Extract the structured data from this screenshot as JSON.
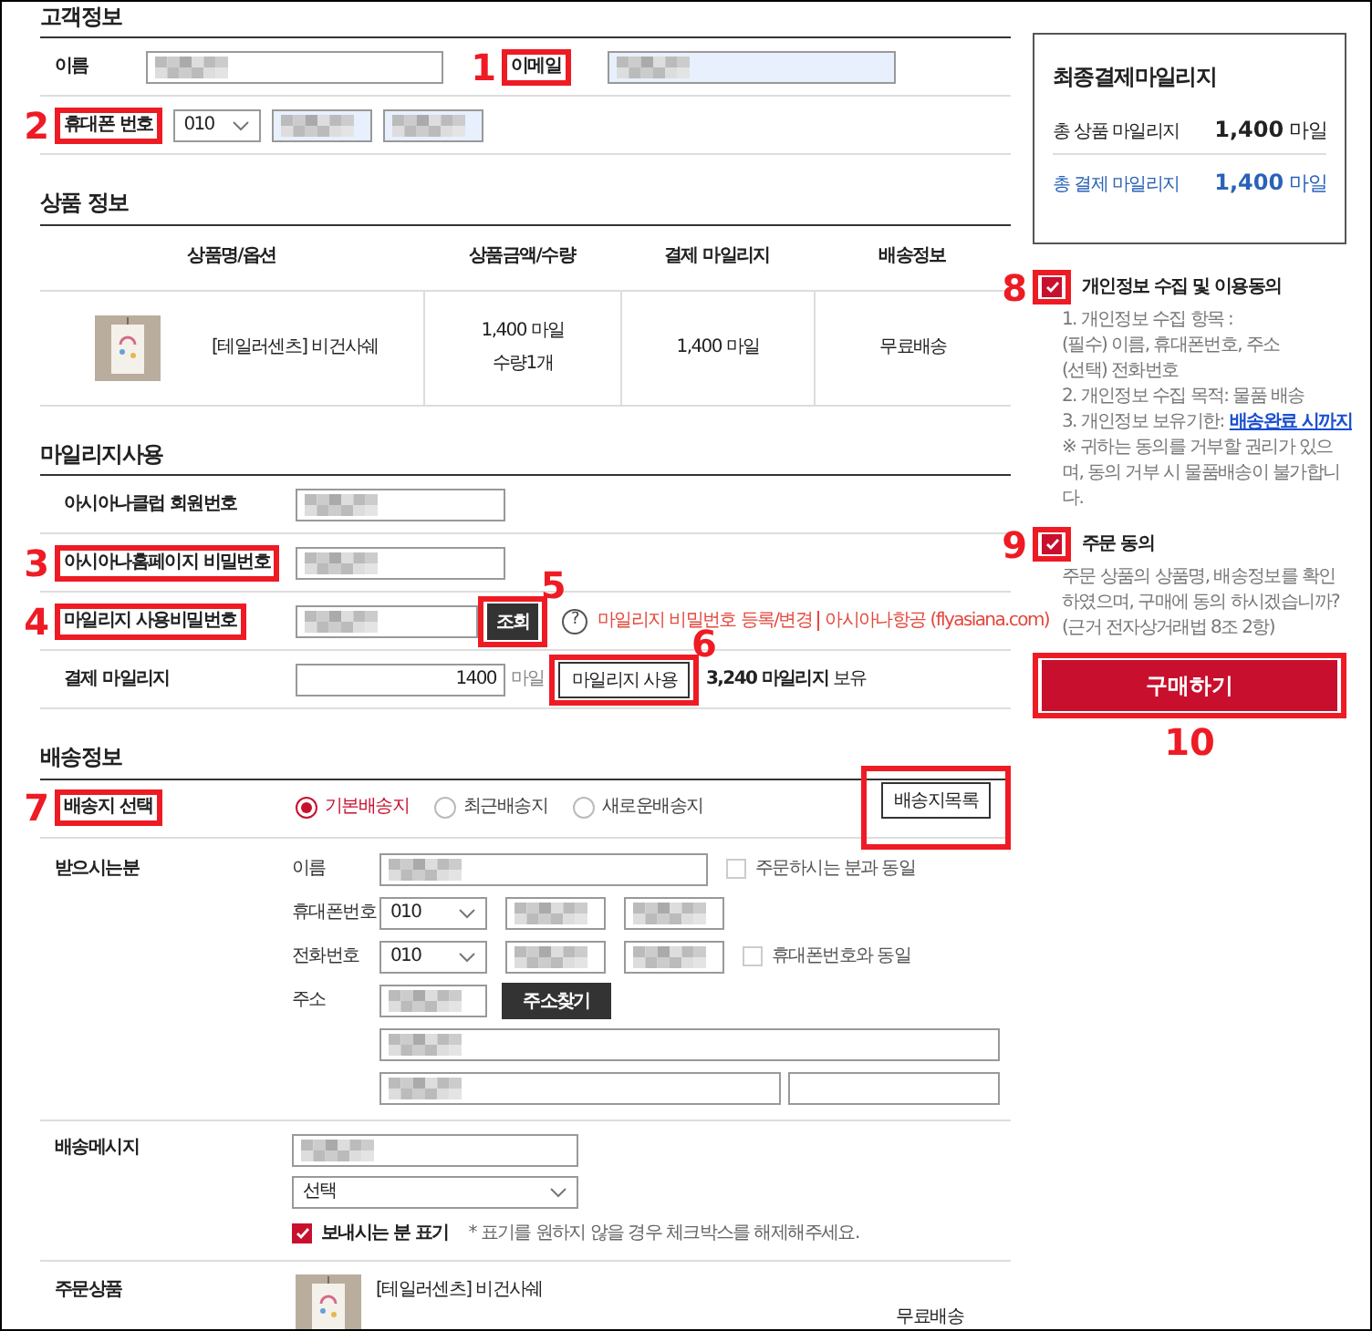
{
  "customer": {
    "title": "고객정보",
    "name": {
      "label": "이름",
      "field": {
        "masked": true,
        "autofill": false
      }
    },
    "email": {
      "label": "이메일",
      "highlight": true,
      "callout": "1",
      "field": {
        "masked": true,
        "autofill": true
      }
    },
    "phone": {
      "label": "휴대폰 번호",
      "highlight": true,
      "callout": "2",
      "prefix": "010",
      "fields": [
        {
          "masked": true,
          "autofill": true
        },
        {
          "masked": true,
          "autofill": true
        }
      ]
    }
  },
  "products": {
    "title": "상품 정보",
    "columns": [
      "상품명/옵션",
      "상품금액/수량",
      "결제 마일리지",
      "배송정보"
    ],
    "rows": [
      {
        "name": "[테일러센츠] 비건사쉐",
        "price": "1,400 마일",
        "quantity": "수량1개",
        "mileage": "1,400 마일",
        "shipping": "무료배송"
      }
    ]
  },
  "mileage": {
    "title": "마일리지사용",
    "rows": [
      {
        "kind": "field",
        "label": "아시아나클럽 회원번호",
        "highlight": false,
        "field": {
          "masked": true
        }
      },
      {
        "kind": "field",
        "label": "아시아나홈페이지 비밀번호",
        "highlight": true,
        "callout": "3",
        "field": {
          "masked": true
        }
      },
      {
        "kind": "lookup",
        "label": "마일리지 사용비밀번호",
        "highlight": true,
        "callout": "4",
        "field": {
          "masked": true
        },
        "button": {
          "label": "조회",
          "highlight": true,
          "callout": "5"
        },
        "help": "?",
        "links": [
          "마일리지 비밀번호 등록/변경",
          "아시아나항공 (flyasiana.com)"
        ]
      },
      {
        "kind": "amount",
        "label": "결제 마일리지",
        "highlight": false,
        "field": {
          "value": "1400"
        },
        "unit": "마일",
        "button": {
          "label": "마일리지 사용",
          "highlight": true,
          "callout": "6"
        },
        "balance": "**3,240 마일리지** 보유"
      }
    ]
  },
  "shipping": {
    "title": "배송정보",
    "select": {
      "label": "배송지 선택",
      "highlight": true,
      "callout": "7",
      "options": [
        {
          "label": "기본배송지",
          "selected": true
        },
        {
          "label": "최근배송지",
          "selected": false
        },
        {
          "label": "새로운배송지",
          "selected": false
        }
      ],
      "list_button": {
        "label": "배송지목록",
        "highlight": true
      }
    },
    "recipient": {
      "label": "받으시는분",
      "name": {
        "label": "이름",
        "field": {
          "masked": true
        },
        "same_as": {
          "label": "주문하시는 분과 동일",
          "checked": false
        }
      },
      "mobile": {
        "label": "휴대폰번호",
        "prefix": "010",
        "fields": [
          {
            "masked": true
          },
          {
            "masked": true
          }
        ]
      },
      "phone": {
        "label": "전화번호",
        "prefix": "010",
        "fields": [
          {
            "masked": true
          },
          {
            "masked": true
          }
        ],
        "same_as": {
          "label": "휴대폰번호와 동일",
          "checked": false
        }
      },
      "address": {
        "label": "주소",
        "zip": {
          "masked": true
        },
        "button": "주소찾기",
        "line1": {
          "masked": true
        },
        "line2": {
          "masked": true
        },
        "line3": {
          "masked": false
        }
      }
    },
    "message": {
      "label": "배송메시지",
      "field": {
        "masked": true
      },
      "select": "선택",
      "sender": {
        "label": "보내시는 분 표기",
        "checked": true
      },
      "note": "* 표기를 원하지 않을 경우 체크박스를 해제해주세요."
    },
    "order_item": {
      "label": "주문상품",
      "name": "[테일러센츠] 비건사쉐",
      "shipping": "무료배송"
    }
  },
  "summary": {
    "title": "최종결제마일리지",
    "rows": [
      {
        "label": "총 상품 마일리지",
        "value": "1,400",
        "unit": "마일",
        "highlight": false
      },
      {
        "label": "총 결제 마일리지",
        "value": "1,400",
        "unit": "마일",
        "highlight": true
      }
    ]
  },
  "agreements": [
    {
      "title": "개인정보 수집 및 이용동의",
      "checked": true,
      "highlight": true,
      "callout": "8",
      "lines": [
        {
          "text": "1. 개인정보 수집 항목 :"
        },
        {
          "text": "(필수) 이름, 휴대폰번호, 주소"
        },
        {
          "text": "(선택) 전화번호"
        },
        {
          "text": "2. 개인정보 수집 목적: 물품 배송"
        },
        {
          "text": "3. 개인정보 보유기한:",
          "link": "배송완료 시까지"
        },
        {
          "text": "※ 귀하는 동의를 거부할 권리가 있으며, 동의 거부 시 물품배송이 불가합니다."
        }
      ]
    },
    {
      "title": "주문 동의",
      "checked": true,
      "highlight": true,
      "callout": "9",
      "lines": [
        {
          "text": "주문 상품의 상품명, 배송정보를 확인하였으며, 구매에 동의 하시겠습니까?"
        },
        {
          "text": "(근거 전자상거래법 8조 2항)"
        }
      ]
    }
  ],
  "purchase": {
    "label": "구매하기",
    "highlight": true,
    "callout": "10"
  }
}
